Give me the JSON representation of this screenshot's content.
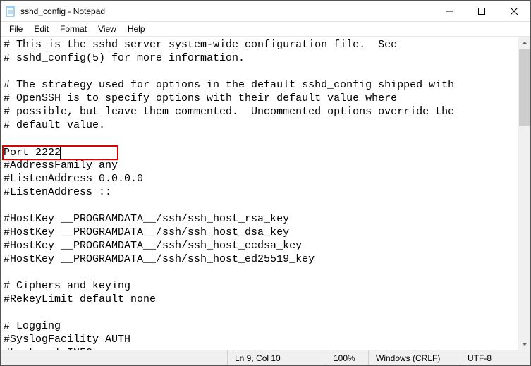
{
  "window": {
    "title": "sshd_config - Notepad"
  },
  "menubar": {
    "file": "File",
    "edit": "Edit",
    "format": "Format",
    "view": "View",
    "help": "Help"
  },
  "content": {
    "lines": [
      "# This is the sshd server system-wide configuration file.  See",
      "# sshd_config(5) for more information.",
      "",
      "# The strategy used for options in the default sshd_config shipped with",
      "# OpenSSH is to specify options with their default value where",
      "# possible, but leave them commented.  Uncommented options override the",
      "# default value.",
      "",
      "Port 2222",
      "#AddressFamily any",
      "#ListenAddress 0.0.0.0",
      "#ListenAddress ::",
      "",
      "#HostKey __PROGRAMDATA__/ssh/ssh_host_rsa_key",
      "#HostKey __PROGRAMDATA__/ssh/ssh_host_dsa_key",
      "#HostKey __PROGRAMDATA__/ssh/ssh_host_ecdsa_key",
      "#HostKey __PROGRAMDATA__/ssh/ssh_host_ed25519_key",
      "",
      "# Ciphers and keying",
      "#RekeyLimit default none",
      "",
      "# Logging",
      "#SyslogFacility AUTH",
      "#LogLevel INFO"
    ],
    "highlighted_line_index": 8
  },
  "statusbar": {
    "pos": "Ln 9, Col 10",
    "zoom": "100%",
    "line_ending": "Windows (CRLF)",
    "encoding": "UTF-8"
  }
}
